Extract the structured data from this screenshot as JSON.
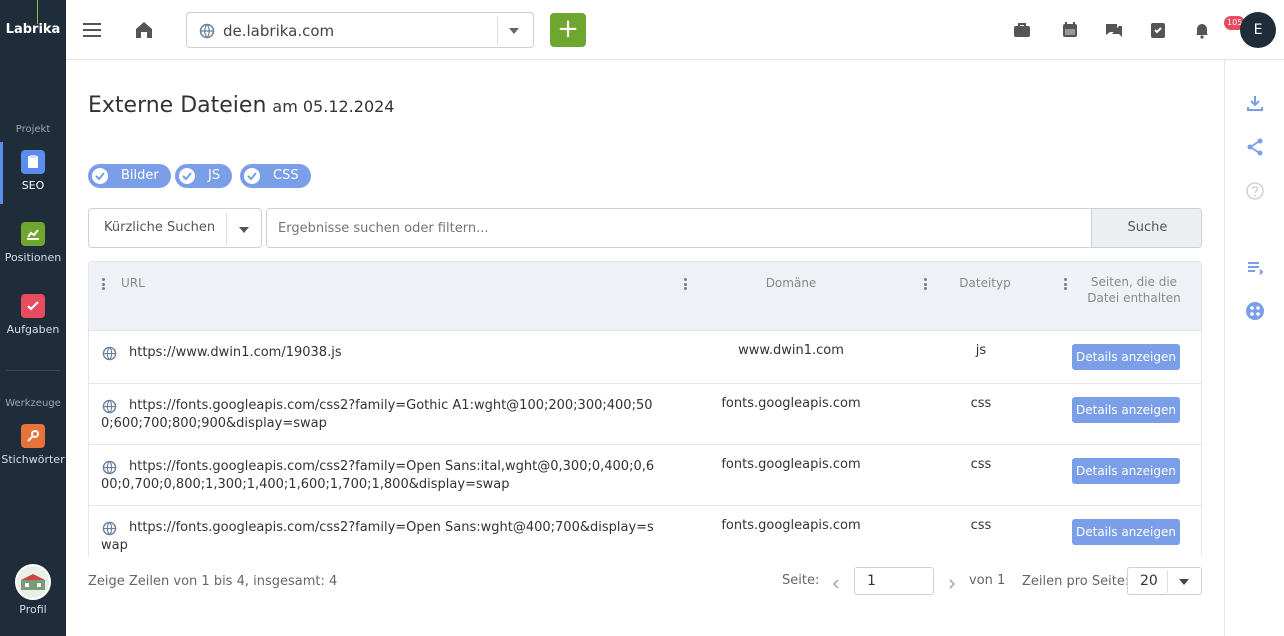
{
  "sidebar": {
    "brand": "Labrika",
    "section_project": "Projekt",
    "section_tools": "Werkzeuge",
    "items": [
      {
        "label": "SEO",
        "icon": "clipboard-icon",
        "color": "#5b8def"
      },
      {
        "label": "Positionen",
        "icon": "chart-icon",
        "color": "#6fa630"
      },
      {
        "label": "Aufgaben",
        "icon": "checkbox-icon",
        "color": "#e84a5f"
      },
      {
        "label": "Stichwörter",
        "icon": "key-icon",
        "color": "#e8733a"
      }
    ],
    "profile_label": "Profil"
  },
  "topbar": {
    "domain": "de.labrika.com",
    "add_label": "+",
    "notification_count": "105",
    "avatar_initial": "E"
  },
  "page": {
    "title": "Externe Dateien",
    "subtitle": "am 05.12.2024"
  },
  "filters": [
    {
      "label": "Bilder"
    },
    {
      "label": "JS"
    },
    {
      "label": "CSS"
    }
  ],
  "search": {
    "recent_label": "Kürzliche Suchen",
    "placeholder": "Ergebnisse suchen oder filtern...",
    "button_label": "Suche"
  },
  "table": {
    "columns": [
      "URL",
      "Domäne",
      "Dateityp",
      "Seiten, die die Datei enthalten"
    ],
    "rows": [
      {
        "url": "https://www.dwin1.com/19038.js",
        "domain": "www.dwin1.com",
        "type": "js",
        "action": "Details anzeigen"
      },
      {
        "url": "https://fonts.googleapis.com/css2?family=Gothic A1:wght@100;200;300;400;500;600;700;800;900&display=swap",
        "domain": "fonts.googleapis.com",
        "type": "css",
        "action": "Details anzeigen"
      },
      {
        "url": "https://fonts.googleapis.com/css2?family=Open Sans:ital,wght@0,300;0,400;0,600;0,700;0,800;1,300;1,400;1,600;1,700;1,800&display=swap",
        "domain": "fonts.googleapis.com",
        "type": "css",
        "action": "Details anzeigen"
      },
      {
        "url": "https://fonts.googleapis.com/css2?family=Open Sans:wght@400;700&display=swap",
        "domain": "fonts.googleapis.com",
        "type": "css",
        "action": "Details anzeigen"
      }
    ]
  },
  "pagination": {
    "info": "Zeige Zeilen von 1 bis 4, insgesamt: 4",
    "page_label": "Seite:",
    "page_value": "1",
    "of_label": "von 1",
    "rows_label": "Zeilen pro Seite:",
    "rows_value": "20"
  }
}
